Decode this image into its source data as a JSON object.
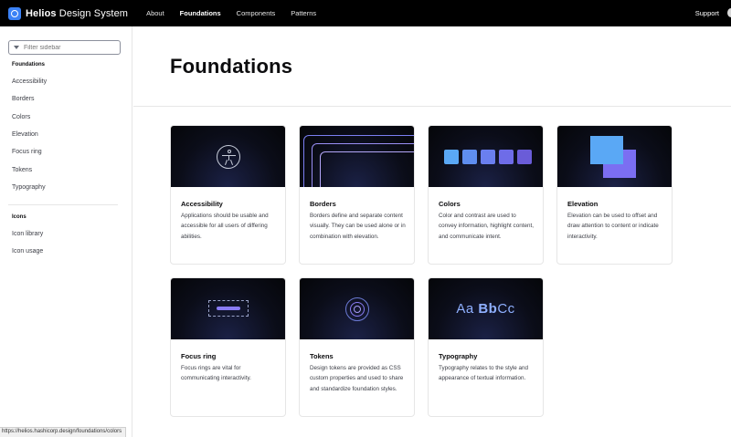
{
  "brand": {
    "name_bold": "Helios",
    "name_rest": " Design System"
  },
  "nav": {
    "items": [
      "About",
      "Foundations",
      "Components",
      "Patterns"
    ],
    "active": "Foundations",
    "support": "Support"
  },
  "sidebar": {
    "filter_placeholder": "Filter sidebar",
    "sections": [
      {
        "heading": "Foundations",
        "items": [
          "Accessibility",
          "Borders",
          "Colors",
          "Elevation",
          "Focus ring",
          "Tokens",
          "Typography"
        ]
      },
      {
        "heading": "Icons",
        "items": [
          "Icon library",
          "Icon usage"
        ]
      }
    ]
  },
  "page": {
    "title": "Foundations"
  },
  "cards": [
    {
      "title": "Accessibility",
      "desc": "Applications should be usable and accessible for all users of differing abilities.",
      "icon": "accessibility-icon"
    },
    {
      "title": "Borders",
      "desc": "Borders define and separate content visually. They can be used alone or in combination with elevation.",
      "icon": "borders-icon"
    },
    {
      "title": "Colors",
      "desc": "Color and contrast are used to convey information, highlight content, and communicate intent.",
      "icon": "color-swatches-icon"
    },
    {
      "title": "Elevation",
      "desc": "Elevation can be used to offset and draw attention to content or indicate interactivity.",
      "icon": "elevation-icon"
    },
    {
      "title": "Focus ring",
      "desc": "Focus rings are vital for communicating interactivity.",
      "icon": "focus-ring-icon"
    },
    {
      "title": "Tokens",
      "desc": "Design tokens are provided as CSS custom properties and used to share and standardize foundation styles.",
      "icon": "tokens-icon"
    },
    {
      "title": "Typography",
      "desc": "Typography relates to the style and appearance of textual information.",
      "icon": "typography-icon"
    }
  ],
  "typography_sample": {
    "a": "Aa",
    "b": "Bb",
    "c": "Cc"
  },
  "colors": {
    "swatches": [
      "#5aa8f5",
      "#5f8ef0",
      "#6a7fef",
      "#6e6ce8",
      "#6a5cd8"
    ],
    "accent": "#3b82f6"
  },
  "status_url": "https://helios.hashicorp.design/foundations/colors"
}
